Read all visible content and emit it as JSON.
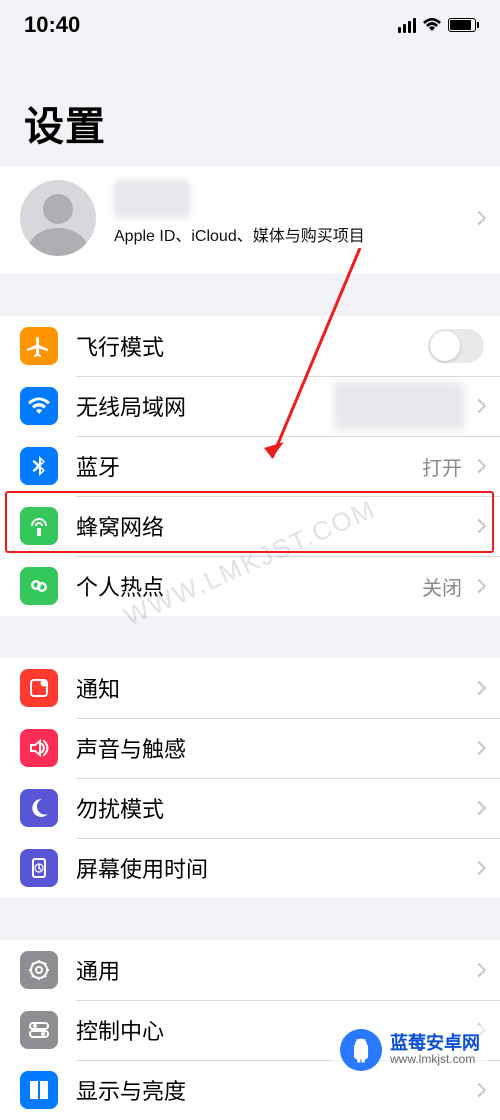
{
  "status": {
    "time": "10:40"
  },
  "title": "设置",
  "profile": {
    "subtitle": "Apple ID、iCloud、媒体与购买项目"
  },
  "group1": {
    "airplane": {
      "label": "飞行模式"
    },
    "wifi": {
      "label": "无线局域网"
    },
    "bt": {
      "label": "蓝牙",
      "value": "打开"
    },
    "cellular": {
      "label": "蜂窝网络"
    },
    "hotspot": {
      "label": "个人热点",
      "value": "关闭"
    }
  },
  "group2": {
    "notify": {
      "label": "通知"
    },
    "sound": {
      "label": "声音与触感"
    },
    "dnd": {
      "label": "勿扰模式"
    },
    "screen": {
      "label": "屏幕使用时间"
    }
  },
  "group3": {
    "general": {
      "label": "通用"
    },
    "control": {
      "label": "控制中心"
    },
    "display": {
      "label": "显示与亮度"
    }
  },
  "watermark": {
    "title": "蓝莓安卓网",
    "url": "www.lmkjst.com",
    "center": "WWW.LMKJST.COM"
  }
}
